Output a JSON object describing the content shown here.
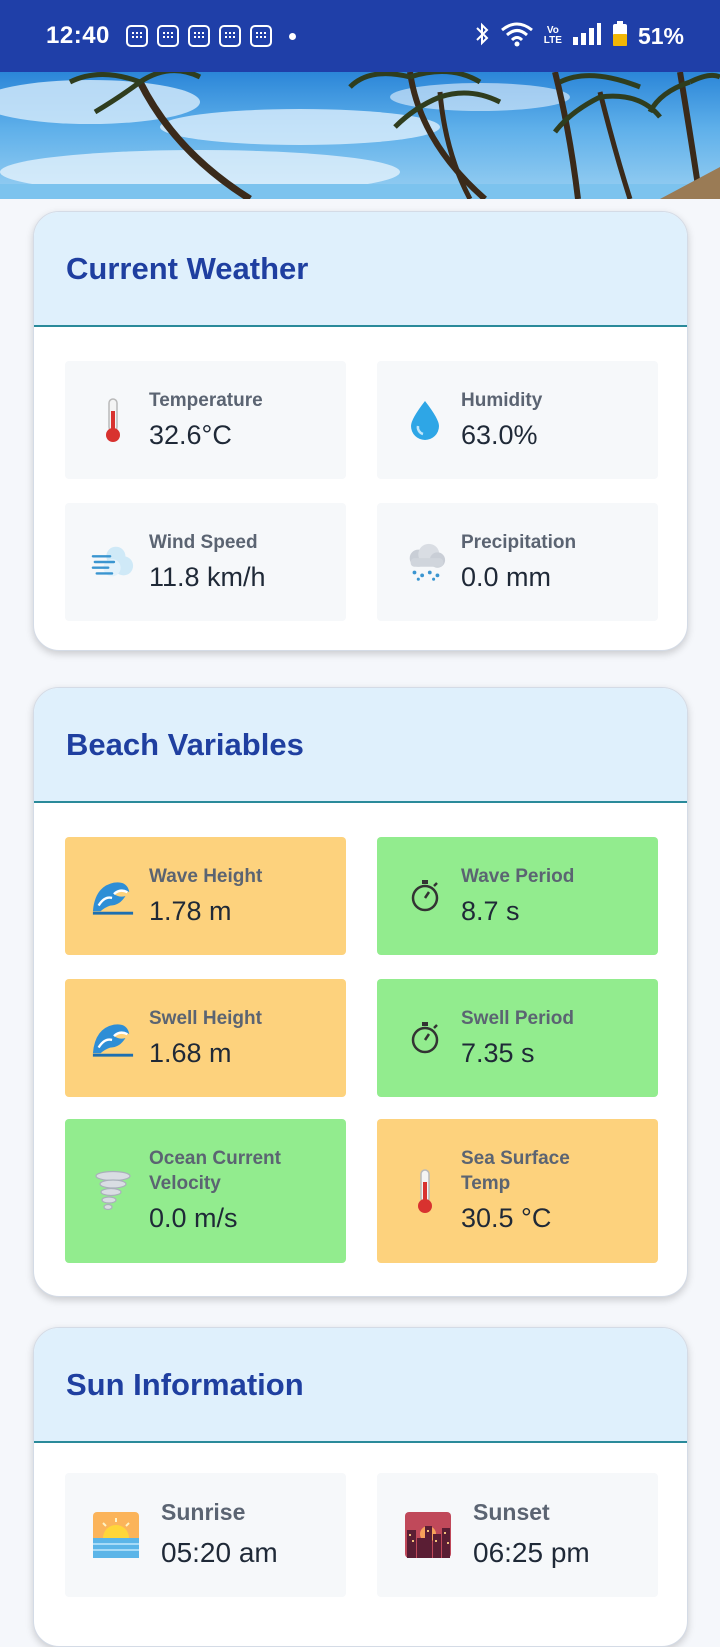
{
  "status_bar": {
    "time": "12:40",
    "battery_percent": "51%",
    "volte": "Vo\nLTE",
    "icons": [
      "notification-icon",
      "notification-icon",
      "notification-icon",
      "notification-icon",
      "notification-icon",
      "bluetooth-icon",
      "wifi-icon",
      "signal-icon",
      "battery-icon"
    ]
  },
  "cards": {
    "current_weather": {
      "title": "Current Weather",
      "tiles": [
        {
          "label": "Temperature",
          "value": "32.6°C",
          "icon": "thermometer-icon"
        },
        {
          "label": "Humidity",
          "value": "63.0%",
          "icon": "water-drop-icon"
        },
        {
          "label": "Wind Speed",
          "value": "11.8 km/h",
          "icon": "wind-icon"
        },
        {
          "label": "Precipitation",
          "value": "0.0 mm",
          "icon": "rain-cloud-icon"
        }
      ]
    },
    "beach_variables": {
      "title": "Beach Variables",
      "tiles": [
        {
          "label": "Wave Height",
          "value": "1.78 m",
          "icon": "wave-icon",
          "status_color": "#fdd27d"
        },
        {
          "label": "Wave Period",
          "value": "8.7 s",
          "icon": "stopwatch-icon",
          "status_color": "#92ec8e"
        },
        {
          "label": "Swell Height",
          "value": "1.68 m",
          "icon": "wave-icon",
          "status_color": "#fdd27d"
        },
        {
          "label": "Swell Period",
          "value": "7.35 s",
          "icon": "stopwatch-icon",
          "status_color": "#92ec8e"
        },
        {
          "label": "Ocean Current Velocity",
          "value": "0.0 m/s",
          "icon": "tornado-icon",
          "status_color": "#92ec8e"
        },
        {
          "label": "Sea Surface Temp",
          "value": "30.5 °C",
          "icon": "thermometer-icon",
          "status_color": "#fdd27d"
        }
      ]
    },
    "sun_information": {
      "title": "Sun Information",
      "tiles": [
        {
          "label": "Sunrise",
          "value": "05:20 am",
          "icon": "sunrise-icon"
        },
        {
          "label": "Sunset",
          "value": "06:25 pm",
          "icon": "sunset-city-icon"
        }
      ]
    }
  },
  "colors": {
    "status_bar": "#1f3fa8",
    "card_title": "#1f3fa0",
    "card_header_bg": "#dff0fc",
    "warning_tile": "#fdd27d",
    "good_tile": "#92ec8e"
  }
}
